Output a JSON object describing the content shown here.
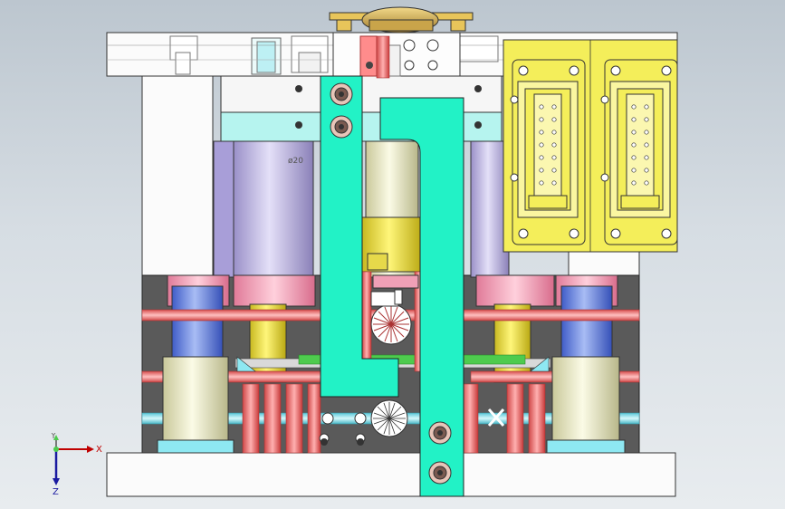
{
  "viewport": {
    "background_top": "#bcc6cf",
    "background_bottom": "#e8ecef"
  },
  "colors": {
    "plate_white": "#fbfbfb",
    "outline": "#333333",
    "cyan_strap": "#22f2c6",
    "yellow_connector": "#f4ee5a",
    "pink_bushing": "#f0a0b6",
    "red_cooling": "#ef6f6f",
    "blue_pillar": "#6e8ae0",
    "gold_pillar": "#e6d94a",
    "light_cyan": "#b6f4ef",
    "lavender": "#c8c0e8",
    "green_accent": "#4ecb4e"
  },
  "triad": {
    "x_label": "X",
    "y_label": "Y",
    "z_label": "Z",
    "x_icon": "x-axis-arrow",
    "y_icon": "y-axis-arrow",
    "z_icon": "z-axis-arrow"
  },
  "model_labels": {
    "cylinder_mark": "ø20"
  }
}
